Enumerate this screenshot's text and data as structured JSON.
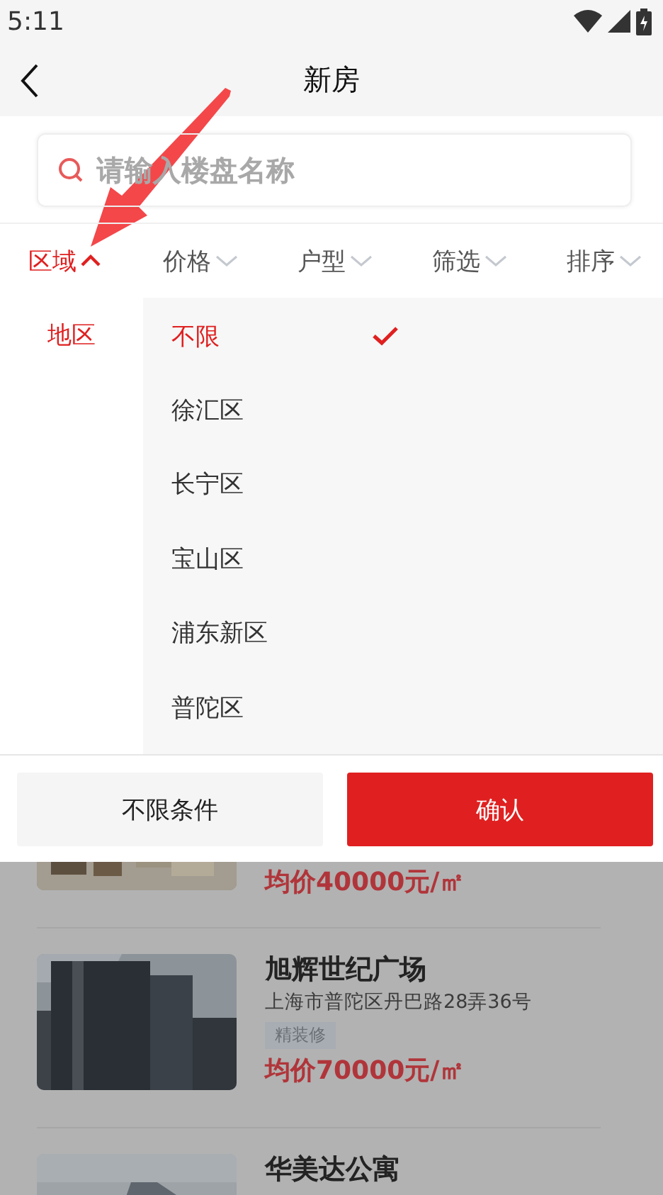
{
  "status_bar": {
    "time": "5:11"
  },
  "header": {
    "title": "新房"
  },
  "search": {
    "placeholder": "请输入楼盘名称"
  },
  "filter_tabs": [
    {
      "label": "区域",
      "selected": true
    },
    {
      "label": "价格",
      "selected": false
    },
    {
      "label": "户型",
      "selected": false
    },
    {
      "label": "筛选",
      "selected": false
    },
    {
      "label": "排序",
      "selected": false
    }
  ],
  "dropdown": {
    "categories": [
      {
        "label": "地区",
        "selected": true
      }
    ],
    "options": [
      {
        "label": "不限",
        "selected": true
      },
      {
        "label": "徐汇区",
        "selected": false
      },
      {
        "label": "长宁区",
        "selected": false
      },
      {
        "label": "宝山区",
        "selected": false
      },
      {
        "label": "浦东新区",
        "selected": false
      },
      {
        "label": "普陀区",
        "selected": false
      }
    ]
  },
  "buttons": [
    {
      "label": "不限条件",
      "kind": "secondary"
    },
    {
      "label": "确认",
      "kind": "primary"
    }
  ],
  "listings": [
    {
      "price": "均价40000元/㎡"
    },
    {
      "name": "旭辉世纪广场",
      "address": "上海市普陀区丹巴路28弄36号",
      "tags": [
        "精装修"
      ],
      "price": "均价70000元/㎡"
    },
    {
      "name": "华美达公寓"
    }
  ]
}
